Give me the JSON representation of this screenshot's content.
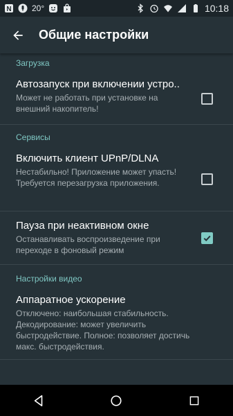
{
  "status_bar": {
    "temperature": "20°",
    "time": "10:18",
    "icons_left": [
      "notification-n-icon",
      "mic-icon",
      "face-icon",
      "shopping-bag-icon"
    ],
    "icons_right": [
      "bluetooth-icon",
      "alarm-icon",
      "wifi-icon",
      "signal-icon",
      "battery-icon"
    ]
  },
  "app_bar": {
    "title": "Общие настройки"
  },
  "sections": [
    {
      "header": "Загрузка",
      "items": [
        {
          "title": "Автозапуск при включении устро..",
          "summary": "Может не работать при установке на внешний накопитель!",
          "checked": false
        }
      ]
    },
    {
      "header": "Сервисы",
      "items": [
        {
          "title": "Включить клиент UPnP/DLNA",
          "summary": "Нестабильно! Приложение может упасть! Требуется перезагрузка приложения.",
          "checked": false
        },
        {
          "title": "Пауза при неактивном окне",
          "summary": "Останавливать воспроизведение при переходе в фоновый режим",
          "checked": true
        }
      ]
    },
    {
      "header": "Настройки видео",
      "items": [
        {
          "title": "Аппаратное ускорение",
          "summary": "Отключено: наибольшая стабильность. Декодирование: может увеличить быстродействие. Полное: позволяет достичь макс. быстродействия."
        }
      ]
    }
  ],
  "colors": {
    "background": "#263238",
    "accent": "#80cbc4",
    "summary_text": "#a7afb3"
  }
}
